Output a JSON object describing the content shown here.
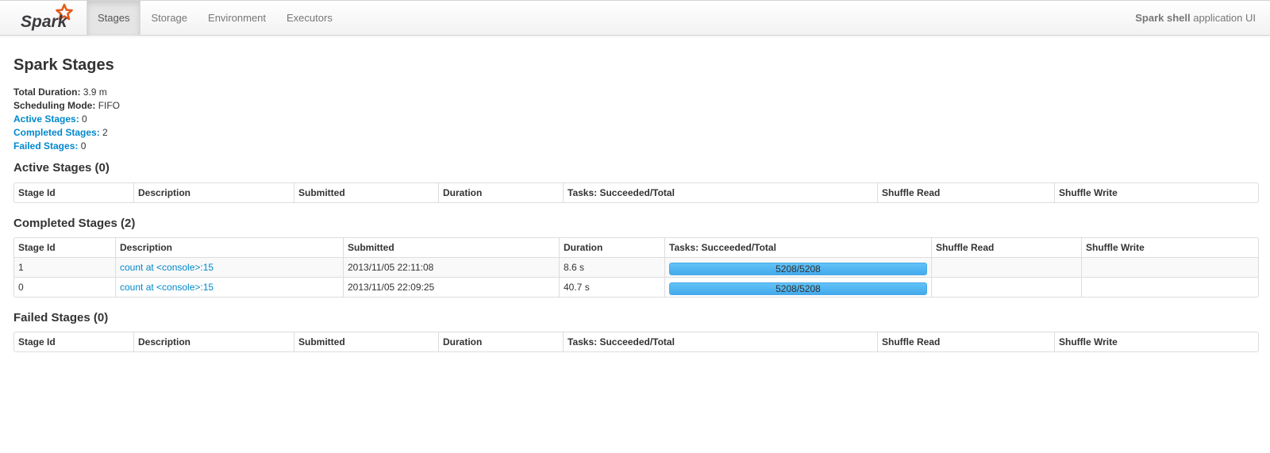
{
  "navbar": {
    "brand": "Spark",
    "tabs": [
      {
        "label": "Stages",
        "active": true
      },
      {
        "label": "Storage",
        "active": false
      },
      {
        "label": "Environment",
        "active": false
      },
      {
        "label": "Executors",
        "active": false
      }
    ],
    "app_name_bold": "Spark shell",
    "app_name_suffix": " application UI"
  },
  "page": {
    "title": "Spark Stages",
    "summary": {
      "total_duration_label": "Total Duration:",
      "total_duration": "3.9 m",
      "scheduling_mode_label": "Scheduling Mode:",
      "scheduling_mode": "FIFO",
      "active_stages_label": "Active Stages:",
      "active_stages": "0",
      "completed_stages_label": "Completed Stages:",
      "completed_stages": "2",
      "failed_stages_label": "Failed Stages:",
      "failed_stages": "0"
    }
  },
  "columns": [
    "Stage Id",
    "Description",
    "Submitted",
    "Duration",
    "Tasks: Succeeded/Total",
    "Shuffle Read",
    "Shuffle Write"
  ],
  "active": {
    "title": "Active Stages (0)",
    "rows": []
  },
  "completed": {
    "title": "Completed Stages (2)",
    "rows": [
      {
        "stage_id": "1",
        "description": "count at <console>:15",
        "submitted": "2013/11/05 22:11:08",
        "duration": "8.6 s",
        "tasks_label": "5208/5208",
        "tasks_fraction": 1.0,
        "shuffle_read": "",
        "shuffle_write": ""
      },
      {
        "stage_id": "0",
        "description": "count at <console>:15",
        "submitted": "2013/11/05 22:09:25",
        "duration": "40.7 s",
        "tasks_label": "5208/5208",
        "tasks_fraction": 1.0,
        "shuffle_read": "",
        "shuffle_write": ""
      }
    ]
  },
  "failed": {
    "title": "Failed Stages (0)",
    "rows": []
  },
  "colors": {
    "link": "#0088cc",
    "progress_bar": "#43a9ec",
    "brand_orange": "#e25a1c"
  }
}
